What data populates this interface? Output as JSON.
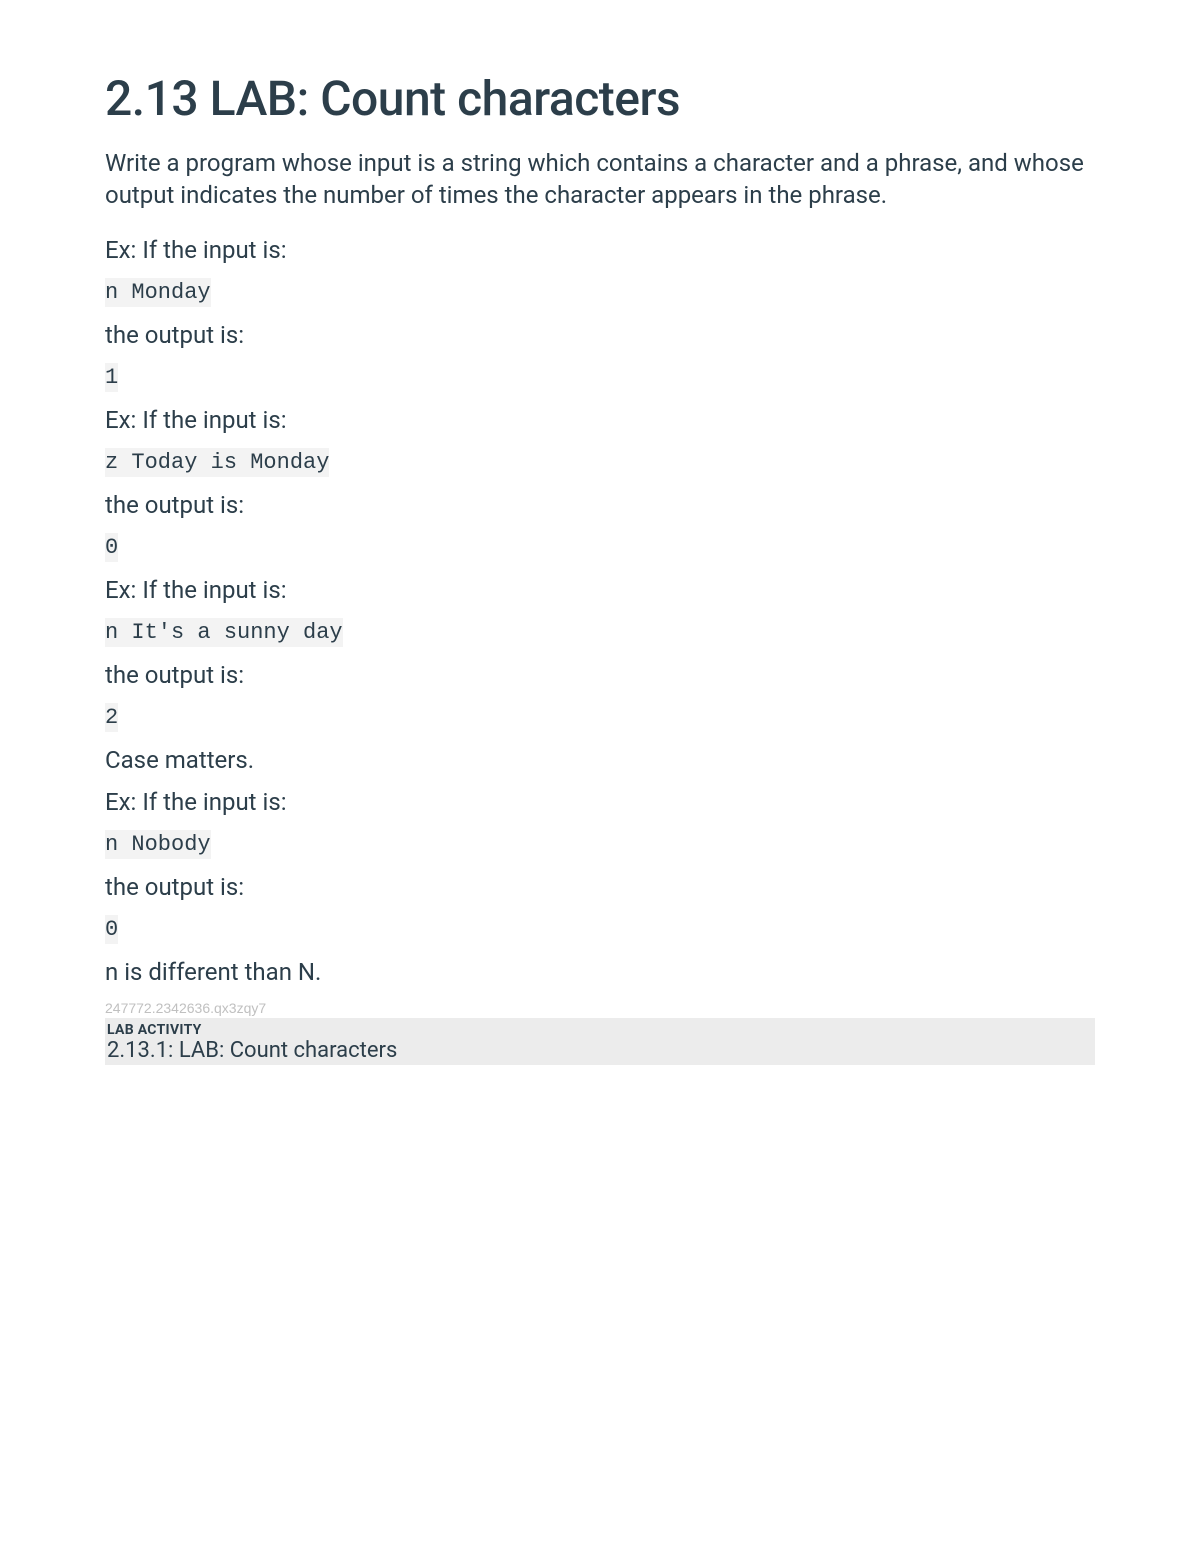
{
  "title": "2.13 LAB: Count characters",
  "intro": "Write a program whose input is a string which contains a character and a phrase, and whose output indicates the number of times the character appears in the phrase.",
  "examples": [
    {
      "prompt": "Ex: If the input is:",
      "input": "n Monday",
      "outputLabel": "the output is:",
      "output": "1"
    },
    {
      "prompt": "Ex: If the input is:",
      "input": "z Today is Monday",
      "outputLabel": "the output is:",
      "output": "0"
    },
    {
      "prompt": "Ex: If the input is:",
      "input": "n It's a sunny day",
      "outputLabel": "the output is:",
      "output": "2"
    }
  ],
  "caseNote": "Case matters.",
  "example4": {
    "prompt": "Ex: If the input is:",
    "input": "n Nobody",
    "outputLabel": "the output is:",
    "output": "0"
  },
  "closingNote": "n is different than N.",
  "hashCode": "247772.2342636.qx3zqy7",
  "labActivity": {
    "label": "LAB ACTIVITY",
    "title": "2.13.1: LAB: Count characters"
  }
}
